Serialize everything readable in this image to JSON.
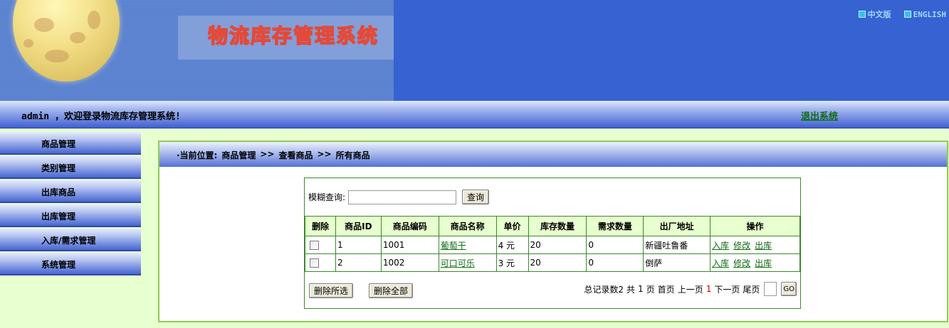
{
  "banner": {
    "logo_text": "物流库存管理系统",
    "lang_cn": "中文版",
    "lang_en": "ENGLISH",
    "colors": {
      "banner_blue": "#2f5bcc",
      "logo_red": "#e24a3a",
      "lang_cyan": "#39c1e8"
    }
  },
  "welcome": {
    "text": "admin ，欢迎登录物流库存管理系统!",
    "logout": "退出系统"
  },
  "nav": {
    "items": [
      {
        "label": "商品管理"
      },
      {
        "label": "类别管理"
      },
      {
        "label": "出库商品"
      },
      {
        "label": "出库管理"
      },
      {
        "label": "入库/需求管理"
      },
      {
        "label": "系统管理"
      }
    ]
  },
  "breadcrumb": {
    "prefix": "·当前位置:",
    "level1": "商品管理",
    "sep": ">>",
    "level2": "查看商品",
    "level3": "所有商品"
  },
  "search": {
    "label": "模糊查询:",
    "value": "",
    "button": "查询"
  },
  "table": {
    "headers": [
      "删除",
      "商品ID",
      "商品编码",
      "商品名称",
      "单价",
      "库存数量",
      "需求数量",
      "出厂地址",
      "操作"
    ],
    "rows": [
      {
        "id": "1",
        "code": "1001",
        "name": "葡萄干",
        "price": "4 元",
        "stock": "20",
        "demand": "0",
        "origin": "新疆吐鲁番"
      },
      {
        "id": "2",
        "code": "1002",
        "name": "可口可乐",
        "price": "3 元",
        "stock": "20",
        "demand": "0",
        "origin": "倒萨"
      }
    ],
    "ops": {
      "in": "入库",
      "edit": "修改",
      "out": "出库"
    }
  },
  "actions": {
    "delete_selected": "删除所选",
    "delete_all": "删除全部"
  },
  "pager": {
    "total": "总记录数2",
    "pages_prefix": "共",
    "pages": "1",
    "pages_suffix": "页",
    "first": "首页",
    "prev": "上一页",
    "current": "1",
    "next": "下一页",
    "last": "尾页",
    "go": "GO"
  }
}
